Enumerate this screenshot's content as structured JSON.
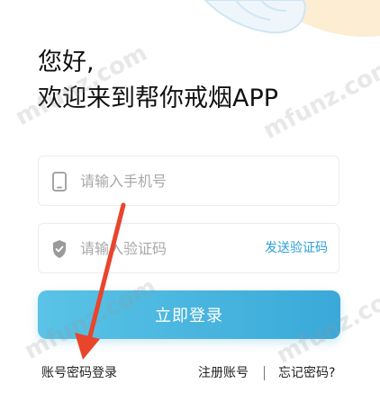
{
  "greeting": {
    "line1": "您好,",
    "line2": "欢迎来到帮你戒烟APP"
  },
  "phone_field": {
    "placeholder": "请输入手机号",
    "icon": "phone-icon"
  },
  "code_field": {
    "placeholder": "请输入验证码",
    "icon": "shield-check-icon",
    "send_code_label": "发送验证码"
  },
  "login_button": {
    "label": "立即登录"
  },
  "bottom_links": {
    "password_login": "账号密码登录",
    "register": "注册账号",
    "forgot_password": "忘记密码?"
  },
  "watermarks": [
    "mfunz.com",
    "mfunz.com",
    "mfunz.com",
    "mfunz.com"
  ],
  "colors": {
    "accent": "#2ea0d8",
    "button_start": "#5ac3e6",
    "button_end": "#3aa9d9",
    "annotation_arrow": "#e8452c"
  }
}
